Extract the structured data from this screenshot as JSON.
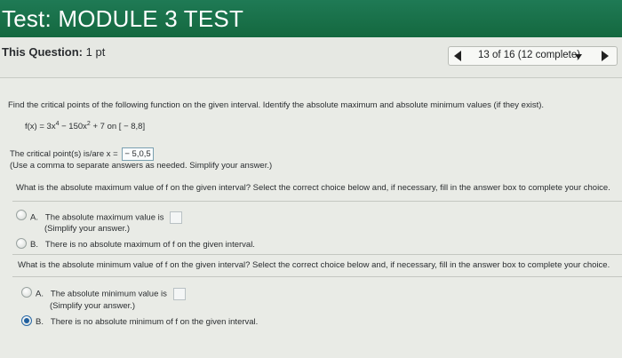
{
  "header": {
    "title": "Test: MODULE 3 TEST"
  },
  "question_bar": {
    "label": "This Question:",
    "points": "1 pt",
    "progress": "13 of 16 (12 complete)"
  },
  "question": {
    "instruction": "Find the critical points of the following function on the given interval. Identify the absolute maximum and absolute minimum values (if they exist).",
    "function_prefix": "f(x) = 3x",
    "exp1": "4",
    "function_mid": " − 150x",
    "exp2": "2",
    "function_suffix": " + 7 on [ − 8,8]",
    "critical_label": "The critical point(s) is/are x =",
    "critical_value": " − 5,0,5",
    "critical_hint": "(Use a comma to separate answers as needed. Simplify your answer.)",
    "max_question": "What is the absolute maximum value of f on the given interval? Select the correct choice below and, if necessary, fill in the answer box to complete your choice.",
    "max_choices": [
      {
        "letter": "A.",
        "text": "The absolute maximum value is",
        "sub": "(Simplify your answer.)",
        "selected": false
      },
      {
        "letter": "B.",
        "text": "There is no absolute maximum of f on the given interval.",
        "selected": false
      }
    ],
    "min_question": "What is the absolute minimum value of f on the given interval? Select the correct choice below and, if necessary, fill in the answer box to complete your choice.",
    "min_choices": [
      {
        "letter": "A.",
        "text": "The absolute minimum value is",
        "sub": "(Simplify your answer.)",
        "selected": false
      },
      {
        "letter": "B.",
        "text": "There is no absolute minimum of f on the given interval.",
        "selected": true
      }
    ]
  },
  "colors": {
    "header_bg": "#1a7049",
    "selected_radio": "#1f5f9e"
  }
}
